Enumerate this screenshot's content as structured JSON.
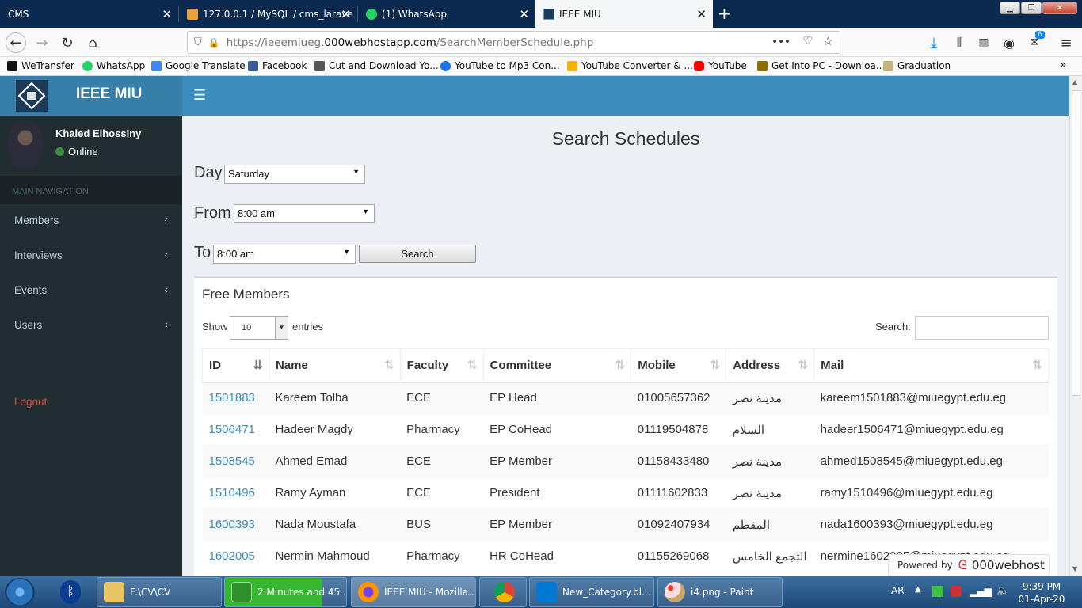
{
  "browser": {
    "tabs": [
      {
        "label": "CMS"
      },
      {
        "label": "127.0.0.1 / MySQL / cms_larave"
      },
      {
        "label": "(1) WhatsApp"
      },
      {
        "label": "IEEE MIU"
      }
    ],
    "url_prefix": "https://ieeemiueg.",
    "url_host": "000webhostapp.com",
    "url_path": "/SearchMemberSchedule.php",
    "url_dots": "•••",
    "library_badge": "6",
    "bookmarks": [
      {
        "label": "WeTransfer",
        "color": "#111111"
      },
      {
        "label": "WhatsApp",
        "color": "#25d366"
      },
      {
        "label": "Google Translate",
        "color": "#4285f4"
      },
      {
        "label": "Facebook",
        "color": "#3b5998"
      },
      {
        "label": "Cut and Download Yo...",
        "color": "#555555"
      },
      {
        "label": "YouTube to Mp3 Con...",
        "color": "#1a73e8"
      },
      {
        "label": "YouTube Converter & ...",
        "color": "#f4b400"
      },
      {
        "label": "YouTube",
        "color": "#ff0000"
      },
      {
        "label": "Get Into PC - Downloa...",
        "color": "#8b6d00"
      },
      {
        "label": "Graduation",
        "color": "#c8b27a"
      }
    ]
  },
  "app": {
    "brand": "IEEE MIU",
    "user_name": "Khaled Elhossiny",
    "user_status": "Online",
    "nav_header": "MAIN NAVIGATION",
    "menu": [
      {
        "label": "Members"
      },
      {
        "label": "Interviews"
      },
      {
        "label": "Events"
      },
      {
        "label": "Users"
      }
    ],
    "logout": "Logout",
    "accent": "#3c8dbc",
    "sidebar_bg": "#222d32"
  },
  "form": {
    "title": "Search Schedules",
    "day_label": "Day",
    "day_value": "Saturday",
    "from_label": "From",
    "from_value": "8:00 am",
    "to_label": "To",
    "to_value": "8:00 am",
    "search_button": "Search"
  },
  "results": {
    "title": "Free Members",
    "show_label": "Show",
    "page_length": "10",
    "entries_label": "entries",
    "search_label": "Search:",
    "columns": [
      "ID",
      "Name",
      "Faculty",
      "Committee",
      "Mobile",
      "Address",
      "Mail"
    ],
    "rows": [
      {
        "id": "1501883",
        "name": "Kareem Tolba",
        "faculty": "ECE",
        "committee": "EP Head",
        "mobile": "01005657362",
        "address": "مدينة نصر",
        "mail": "kareem1501883@miuegypt.edu.eg"
      },
      {
        "id": "1506471",
        "name": "Hadeer Magdy",
        "faculty": "Pharmacy",
        "committee": "EP CoHead",
        "mobile": "01119504878",
        "address": "السلام",
        "mail": "hadeer1506471@miuegypt.edu.eg"
      },
      {
        "id": "1508545",
        "name": "Ahmed Emad",
        "faculty": "ECE",
        "committee": "EP Member",
        "mobile": "01158433480",
        "address": "مدينة نصر",
        "mail": "ahmed1508545@miuegypt.edu.eg"
      },
      {
        "id": "1510496",
        "name": "Ramy Ayman",
        "faculty": "ECE",
        "committee": "President",
        "mobile": "01111602833",
        "address": "مدينة نصر",
        "mail": "ramy1510496@miuegypt.edu.eg"
      },
      {
        "id": "1600393",
        "name": "Nada Moustafa",
        "faculty": "BUS",
        "committee": "EP Member",
        "mobile": "01092407934",
        "address": "المقطم",
        "mail": "nada1600393@miuegypt.edu.eg"
      },
      {
        "id": "1602005",
        "name": "Nermin Mahmoud",
        "faculty": "Pharmacy",
        "committee": "HR CoHead",
        "mobile": "01155269068",
        "address": "التجمع الخامس",
        "mail": "nermine1602005@miuegypt.edu.eg"
      }
    ]
  },
  "badge": {
    "powered_label": "Powered by",
    "brand": "000webhost"
  },
  "taskbar": {
    "items": [
      {
        "label": "F:\\CV\\CV"
      },
      {
        "label": "2 Minutes and 45 ..."
      },
      {
        "label": "IEEE MIU - Mozilla..."
      },
      {
        "label": ""
      },
      {
        "label": "New_Category.bl..."
      },
      {
        "label": "i4.png - Paint"
      }
    ],
    "language": "AR",
    "time": "9:39 PM",
    "date": "01-Apr-20"
  }
}
